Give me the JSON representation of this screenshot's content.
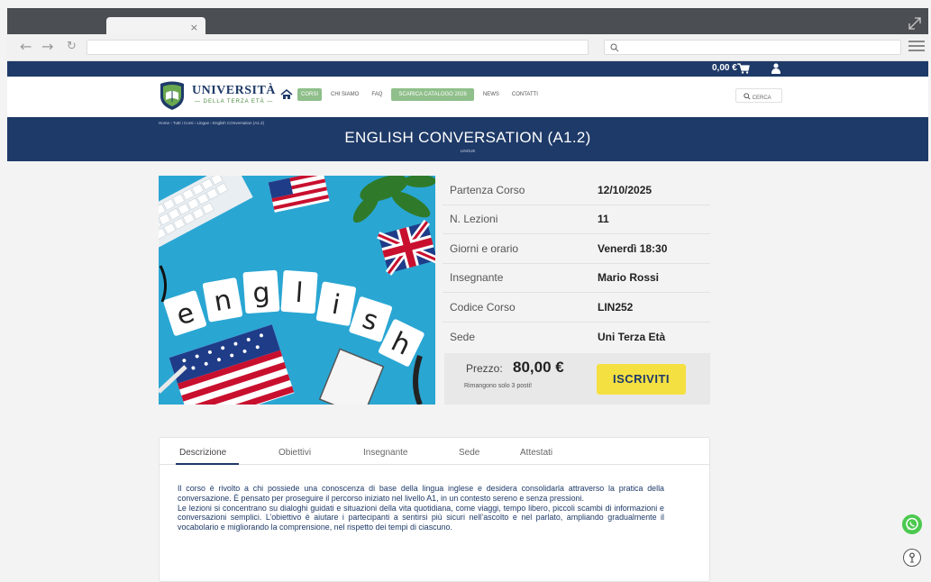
{
  "browser": {
    "tab_close": "×",
    "back": "←",
    "forward": "→",
    "reload": "↻"
  },
  "topbar": {
    "cart_total": "0,00 €"
  },
  "header": {
    "logo_title": "UNIVERSITÀ",
    "logo_subtitle": "— DELLA TERZA ETÀ —",
    "nav": [
      "CORSI",
      "CHI SIAMO",
      "FAQ",
      "SCARICA CATALOGO 2026",
      "NEWS",
      "CONTATTI"
    ],
    "search_label": "CERCA"
  },
  "banner": {
    "breadcrumb": "Home › Tutti i Corsi › Lingue › English COnversation (A1.2)",
    "title": "ENGLISH CONVERSATION (A1.2)",
    "category": "LINGUE"
  },
  "course_image": {
    "tiles": [
      "e",
      "n",
      "g",
      "l",
      "i",
      "s",
      "h"
    ]
  },
  "info": [
    {
      "label": "Partenza Corso",
      "value": "12/10/2025"
    },
    {
      "label": "N. Lezioni",
      "value": "11"
    },
    {
      "label": "Giorni e orario",
      "value": "Venerdì 18:30"
    },
    {
      "label": "Insegnante",
      "value": "Mario Rossi"
    },
    {
      "label": "Codice Corso",
      "value": "LIN252"
    },
    {
      "label": "Sede",
      "value": "Uni Terza Età"
    }
  ],
  "price": {
    "label": "Prezzo:",
    "value": "80,00 €",
    "note": "Rimangono solo 3 posti!",
    "button": "ISCRIVITI"
  },
  "tabs": [
    "Descrizione",
    "Obiettivi",
    "Insegnante",
    "Sede",
    "Attestati"
  ],
  "description": {
    "p1": "Il corso è rivolto a chi possiede una conoscenza di base della lingua inglese e desidera consolidarla attraverso la pratica della conversazione. È pensato per proseguire il percorso iniziato nel livello A1, in un contesto sereno e senza pressioni.",
    "p2": "Le lezioni si concentrano su dialoghi guidati e situazioni della vita quotidiana, come viaggi, tempo libero, piccoli scambi di informazioni e conversazioni semplici. L’obiettivo è aiutare i partecipanti a sentirsi più sicuri nell’ascolto e nel parlato, ampliando gradualmente il vocabolario e migliorando la comprensione, nel rispetto dei tempi di ciascuno."
  },
  "colors": {
    "navy": "#1e3a68",
    "green": "#8fbf8a",
    "button_yellow": "#f5e042",
    "whatsapp": "#4cc94f"
  }
}
